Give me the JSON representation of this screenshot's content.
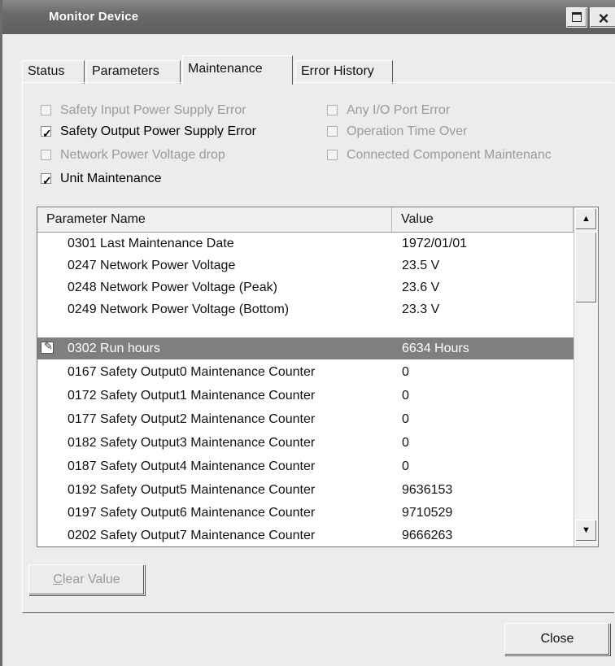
{
  "window": {
    "title": "Monitor Device"
  },
  "tabs": [
    {
      "label": "Status",
      "active": false
    },
    {
      "label": "Parameters",
      "active": false
    },
    {
      "label": "Maintenance",
      "active": true
    },
    {
      "label": "Error History",
      "active": false
    }
  ],
  "checkboxes": [
    {
      "label": "Safety Input Power Supply Error",
      "checked": false,
      "enabled": false
    },
    {
      "label": "Safety Output Power Supply Error",
      "checked": true,
      "enabled": true
    },
    {
      "label": "Network Power Voltage drop",
      "checked": false,
      "enabled": false
    },
    {
      "label": "Unit Maintenance",
      "checked": true,
      "enabled": true
    },
    {
      "label": "Any I/O Port Error",
      "checked": false,
      "enabled": false
    },
    {
      "label": "Operation Time Over",
      "checked": false,
      "enabled": false
    },
    {
      "label": "Connected Component Maintenanc",
      "checked": false,
      "enabled": false
    }
  ],
  "table": {
    "columns": [
      "Parameter Name",
      "Value"
    ],
    "rows": [
      {
        "name": "0301 Last Maintenance Date",
        "value": "1972/01/01"
      },
      {
        "name": "0247 Network Power Voltage",
        "value": "23.5 V"
      },
      {
        "name": "0248 Network Power Voltage (Peak)",
        "value": "23.6 V"
      },
      {
        "name": "0249 Network Power Voltage (Bottom)",
        "value": "23.3 V"
      },
      {
        "name": "0302 Run hours",
        "value": "6634 Hours",
        "selected": true
      },
      {
        "name": "0167 Safety Output0 Maintenance Counter",
        "value": "0"
      },
      {
        "name": "0172 Safety Output1 Maintenance Counter",
        "value": "0"
      },
      {
        "name": "0177 Safety Output2 Maintenance Counter",
        "value": "0"
      },
      {
        "name": "0182 Safety Output3 Maintenance Counter",
        "value": "0"
      },
      {
        "name": "0187 Safety Output4 Maintenance Counter",
        "value": "0"
      },
      {
        "name": "0192 Safety Output5 Maintenance Counter",
        "value": "9636153"
      },
      {
        "name": "0197 Safety Output6 Maintenance Counter",
        "value": "9710529"
      },
      {
        "name": "0202 Safety Output7 Maintenance Counter",
        "value": "9666263"
      }
    ]
  },
  "buttons": {
    "clear_value": {
      "hotkey": "C",
      "rest": "lear Value",
      "enabled": false
    },
    "close": "Close"
  },
  "icons": {
    "maximize": "maximize-icon",
    "close": "close-icon",
    "edit": "pencil-icon",
    "scroll_up": "scroll-up-icon",
    "scroll_down": "scroll-down-icon"
  }
}
